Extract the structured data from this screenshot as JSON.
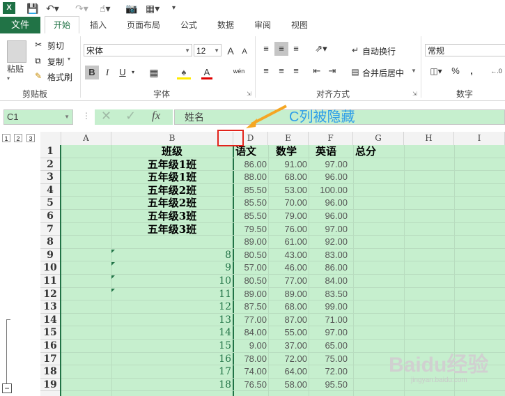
{
  "quick_access": {
    "logo": "X",
    "save_icon": "save-icon",
    "undo_icon": "undo-icon",
    "redo_icon": "redo-icon",
    "touch_icon": "touch-mode-icon",
    "camera_icon": "camera-icon",
    "form_icon": "form-icon"
  },
  "tabs": {
    "file": "文件",
    "home": "开始",
    "insert": "插入",
    "layout": "页面布局",
    "formulas": "公式",
    "data": "数据",
    "review": "审阅",
    "view": "视图"
  },
  "ribbon": {
    "clipboard": {
      "paste": "粘贴",
      "cut": "剪切",
      "copy": "复制",
      "format_painter": "格式刷",
      "label": "剪贴板"
    },
    "font": {
      "name": "宋体",
      "size": "12",
      "bold": "B",
      "italic": "I",
      "underline": "U",
      "label": "字体",
      "grow": "A",
      "shrink": "A",
      "phonetic": "wén"
    },
    "alignment": {
      "wrap": "自动换行",
      "merge": "合并后居中",
      "label": "对齐方式"
    },
    "number": {
      "format": "常规",
      "percent": "%",
      "comma": ",",
      "label": "数字"
    }
  },
  "formula_bar": {
    "name_box": "C1",
    "formula": "姓名",
    "fx": "fx"
  },
  "outline_levels": [
    "1",
    "2",
    "3"
  ],
  "columns": [
    "A",
    "B",
    "D",
    "E",
    "F",
    "G",
    "H",
    "I"
  ],
  "header_row": {
    "b": "班级",
    "d": "语文",
    "e": "数学",
    "f": "英语",
    "g": "总分"
  },
  "rows": [
    {
      "r": "1"
    },
    {
      "r": "2",
      "b": "五年级1班",
      "d": "86.00",
      "e": "91.00",
      "f": "97.00"
    },
    {
      "r": "3",
      "b": "五年级1班",
      "d": "88.00",
      "e": "68.00",
      "f": "96.00"
    },
    {
      "r": "4",
      "b": "五年级2班",
      "d": "85.50",
      "e": "53.00",
      "f": "100.00"
    },
    {
      "r": "5",
      "b": "五年级2班",
      "d": "85.50",
      "e": "70.00",
      "f": "96.00"
    },
    {
      "r": "6",
      "b": "五年级3班",
      "d": "85.50",
      "e": "79.00",
      "f": "96.00"
    },
    {
      "r": "7",
      "b": "五年级3班",
      "d": "79.50",
      "e": "76.00",
      "f": "97.00"
    },
    {
      "r": "8",
      "d": "89.00",
      "e": "61.00",
      "f": "92.00"
    },
    {
      "r": "9",
      "bn": "8",
      "d": "80.50",
      "e": "43.00",
      "f": "83.00"
    },
    {
      "r": "10",
      "bn": "9",
      "d": "57.00",
      "e": "46.00",
      "f": "86.00"
    },
    {
      "r": "11",
      "bn": "10",
      "d": "80.50",
      "e": "77.00",
      "f": "84.00"
    },
    {
      "r": "12",
      "bn": "11",
      "d": "89.00",
      "e": "89.00",
      "f": "83.50"
    },
    {
      "r": "13",
      "bn": "12",
      "d": "87.50",
      "e": "68.00",
      "f": "99.00"
    },
    {
      "r": "14",
      "bn": "13",
      "d": "77.00",
      "e": "87.00",
      "f": "71.00"
    },
    {
      "r": "15",
      "bn": "14",
      "d": "84.00",
      "e": "55.00",
      "f": "97.00"
    },
    {
      "r": "16",
      "bn": "15",
      "d": "9.00",
      "e": "37.00",
      "f": "65.00"
    },
    {
      "r": "17",
      "bn": "16",
      "d": "78.00",
      "e": "72.00",
      "f": "75.00"
    },
    {
      "r": "18",
      "bn": "17",
      "d": "74.00",
      "e": "64.00",
      "f": "72.00"
    },
    {
      "r": "19",
      "bn": "18",
      "d": "76.50",
      "e": "58.00",
      "f": "95.50"
    }
  ],
  "annotation": "C列被隐藏",
  "watermark": {
    "brand": "Baidu经验",
    "url": "jingyan.baidu.com"
  },
  "colors": {
    "excel_green": "#217346",
    "cell_fill": "#c6efce",
    "annotation_blue": "#2e9ee8",
    "highlight_red": "#e2231a"
  }
}
